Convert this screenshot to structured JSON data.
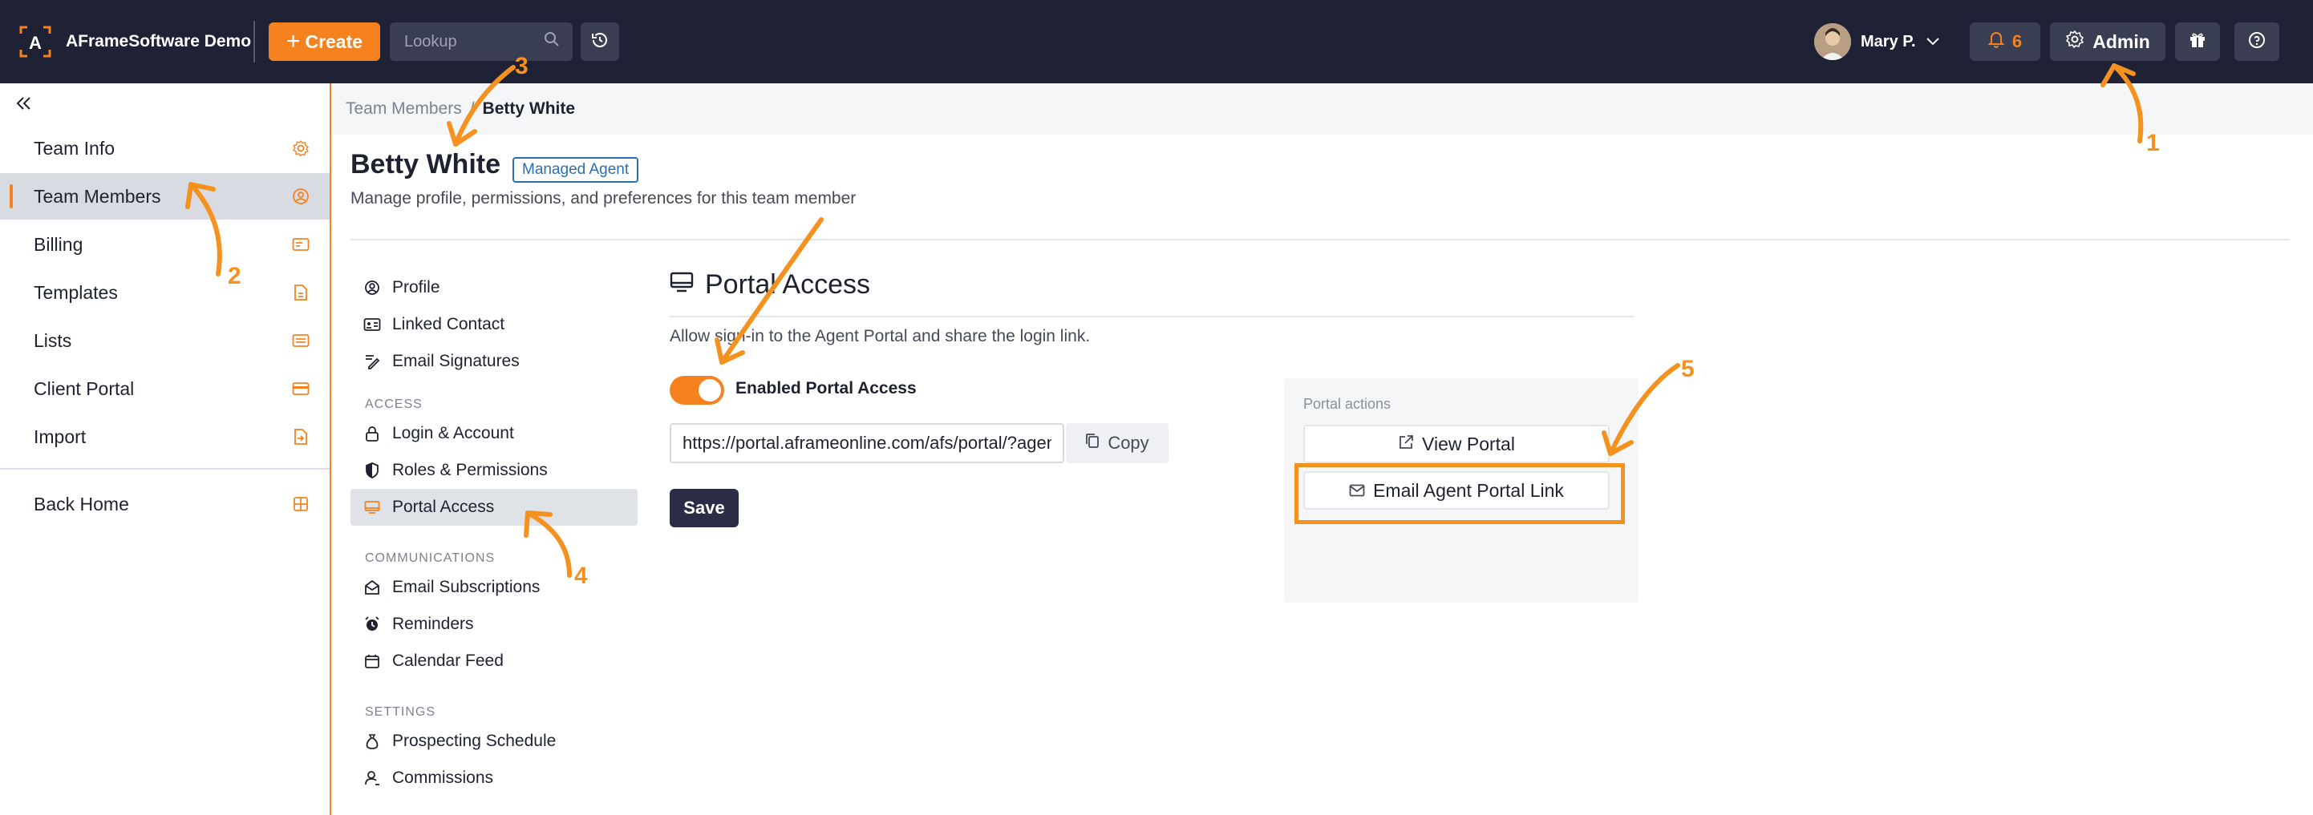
{
  "topbar": {
    "brand": "AFrameSoftware Demo",
    "create_label": "Create",
    "lookup_placeholder": "Lookup",
    "user_name": "Mary P.",
    "notification_count": "6",
    "admin_label": "Admin"
  },
  "sidebar": {
    "items": [
      {
        "label": "Team Info",
        "icon": "gear-icon"
      },
      {
        "label": "Team Members",
        "icon": "user-circle-icon",
        "active": true
      },
      {
        "label": "Billing",
        "icon": "billing-card-icon"
      },
      {
        "label": "Templates",
        "icon": "document-icon"
      },
      {
        "label": "Lists",
        "icon": "list-card-icon"
      },
      {
        "label": "Client Portal",
        "icon": "portal-card-icon"
      },
      {
        "label": "Import",
        "icon": "import-file-icon"
      }
    ],
    "back_home": "Back Home"
  },
  "breadcrumb": {
    "parent": "Team Members",
    "separator": "/",
    "current": "Betty White"
  },
  "member": {
    "name": "Betty White",
    "badge": "Managed Agent",
    "subtitle": "Manage profile, permissions, and preferences for this team member"
  },
  "subnav": {
    "general": [
      "Profile",
      "Linked Contact",
      "Email Signatures"
    ],
    "access_header": "ACCESS",
    "access": [
      "Login & Account",
      "Roles & Permissions",
      "Portal Access"
    ],
    "communications_header": "COMMUNICATIONS",
    "communications": [
      "Email Subscriptions",
      "Reminders",
      "Calendar Feed"
    ],
    "settings_header": "SETTINGS",
    "settings": [
      "Prospecting Schedule",
      "Commissions"
    ],
    "active": "Portal Access"
  },
  "portal_access": {
    "title": "Portal Access",
    "description": "Allow sign-in to the Agent Portal and share the login link.",
    "toggle_label": "Enabled Portal Access",
    "toggle_on": true,
    "url": "https://portal.aframeonline.com/afs/portal/?agentUid",
    "copy_label": "Copy",
    "save_label": "Save",
    "actions_title": "Portal actions",
    "view_portal_label": "View Portal",
    "email_link_label": "Email Agent Portal Link"
  },
  "annotations": [
    "1",
    "2",
    "3",
    "4",
    "5"
  ],
  "colors": {
    "accent": "#f5821f",
    "topbar": "#1f2235",
    "badge": "#2a6fb0"
  }
}
